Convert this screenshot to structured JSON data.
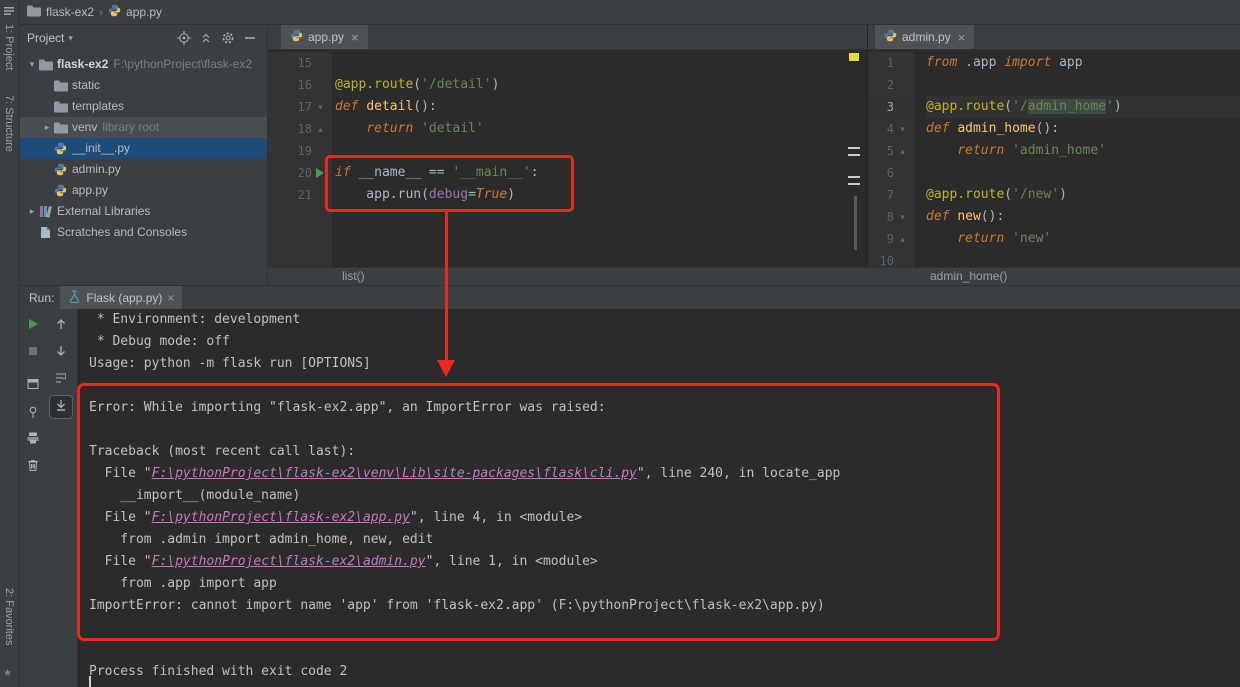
{
  "colors": {
    "panel_bg": "#3c3f41",
    "editor_bg": "#2b2b2b",
    "selection_blue": "#1e4b77",
    "annotation_red": "#ea2820",
    "console_link": "#cb76c0",
    "keyword_orange": "#cc7832",
    "string_green": "#6a8759",
    "decorator_yellow": "#bbb529",
    "function_yellow": "#ffc66b",
    "stripe_yellow": "#dede3f",
    "run_green": "#499c54"
  },
  "left_strip": {
    "project": "1: Project",
    "structure": "7: Structure",
    "favorites": "2: Favorites"
  },
  "top_bar": {
    "project": "flask-ex2",
    "file": "app.py"
  },
  "project": {
    "header": "Project",
    "tree": [
      {
        "label": "flask-ex2",
        "hint": "F:\\pythonProject\\flask-ex2",
        "icon": "folder",
        "chevron": "open",
        "indent": 0,
        "bold": true
      },
      {
        "label": "static",
        "icon": "folder",
        "indent": 1
      },
      {
        "label": "templates",
        "icon": "folder",
        "indent": 1
      },
      {
        "label": "venv",
        "hint": "library root",
        "icon": "folder",
        "chevron": "closed",
        "indent": 1,
        "hover": true
      },
      {
        "label": "__init__.py",
        "icon": "python",
        "indent": 1,
        "selected": true
      },
      {
        "label": "admin.py",
        "icon": "python",
        "indent": 1
      },
      {
        "label": "app.py",
        "icon": "python",
        "indent": 1
      },
      {
        "label": "External Libraries",
        "icon": "libs",
        "chevron": "closed",
        "indent": 0
      },
      {
        "label": "Scratches and Consoles",
        "icon": "scratch",
        "indent": 0
      }
    ]
  },
  "editor_left": {
    "tab": "app.py",
    "breadcrumb": "list()",
    "lines": [
      {
        "n": 15,
        "tokens": []
      },
      {
        "n": 16,
        "tokens": [
          [
            "d",
            "@app.route"
          ],
          [
            "p",
            "("
          ],
          [
            "s",
            "'/detail'"
          ],
          [
            "p",
            ")"
          ]
        ]
      },
      {
        "n": 17,
        "gutter": "fold-open",
        "tokens": [
          [
            "k",
            "def "
          ],
          [
            "f",
            "detail"
          ],
          [
            "p",
            "():"
          ]
        ]
      },
      {
        "n": 18,
        "gutter": "fold-close",
        "tokens": [
          [
            "p",
            "    "
          ],
          [
            "k",
            "return "
          ],
          [
            "s",
            "'detail'"
          ]
        ]
      },
      {
        "n": 19,
        "tokens": []
      },
      {
        "n": 20,
        "gutter": "run",
        "tokens": [
          [
            "k",
            "if "
          ],
          [
            "p",
            "__name__ == "
          ],
          [
            "s",
            "'__main__'"
          ],
          [
            "p",
            ":"
          ]
        ]
      },
      {
        "n": 21,
        "tokens": [
          [
            "p",
            "    app.run("
          ],
          [
            "v",
            "debug"
          ],
          [
            "p",
            "="
          ],
          [
            "k",
            "True"
          ],
          [
            "p",
            ")"
          ]
        ]
      }
    ]
  },
  "editor_right": {
    "tab": "admin.py",
    "breadcrumb": "admin_home()",
    "lines": [
      {
        "n": 1,
        "tokens": [
          [
            "k",
            "from "
          ],
          [
            "p",
            ".app "
          ],
          [
            "k",
            "import "
          ],
          [
            "p",
            "app"
          ]
        ]
      },
      {
        "n": 2,
        "tokens": []
      },
      {
        "n": 3,
        "highlight": true,
        "tokens": [
          [
            "d",
            "@app.route"
          ],
          [
            "p",
            "("
          ],
          [
            "s",
            "'/"
          ],
          [
            "sh",
            "admin_home"
          ],
          [
            "s",
            "'"
          ],
          [
            "p",
            ")"
          ]
        ]
      },
      {
        "n": 4,
        "gutter": "fold-open",
        "tokens": [
          [
            "k",
            "def "
          ],
          [
            "f",
            "admin_home"
          ],
          [
            "p",
            "():"
          ]
        ]
      },
      {
        "n": 5,
        "gutter": "fold-close",
        "tokens": [
          [
            "p",
            "    "
          ],
          [
            "k",
            "return "
          ],
          [
            "s",
            "'admin_home'"
          ]
        ]
      },
      {
        "n": 6,
        "tokens": []
      },
      {
        "n": 7,
        "tokens": [
          [
            "d",
            "@app.route"
          ],
          [
            "p",
            "("
          ],
          [
            "s",
            "'/new'"
          ],
          [
            "p",
            ")"
          ]
        ]
      },
      {
        "n": 8,
        "gutter": "fold-open",
        "tokens": [
          [
            "k",
            "def "
          ],
          [
            "f",
            "new"
          ],
          [
            "p",
            "():"
          ]
        ]
      },
      {
        "n": 9,
        "gutter": "fold-close",
        "tokens": [
          [
            "p",
            "    "
          ],
          [
            "k",
            "return "
          ],
          [
            "s",
            "'new'"
          ]
        ]
      },
      {
        "n": 10,
        "tokens": []
      }
    ]
  },
  "run_panel": {
    "label": "Run:",
    "tab": "Flask (app.py)",
    "console": [
      [
        [
          "t",
          " * Environment: development"
        ]
      ],
      [
        [
          "t",
          " * Debug mode: off"
        ]
      ],
      [
        [
          "t",
          "Usage: python -m flask run [OPTIONS]"
        ]
      ],
      [],
      [
        [
          "t",
          "Error: While importing \"flask-ex2.app\", an ImportError was raised:"
        ]
      ],
      [],
      [
        [
          "t",
          "Traceback (most recent call last):"
        ]
      ],
      [
        [
          "t",
          "  File \""
        ],
        [
          "l",
          "F:\\pythonProject\\flask-ex2\\venv\\Lib\\site-packages\\flask\\cli.py"
        ],
        [
          "t",
          "\", line 240, in locate_app"
        ]
      ],
      [
        [
          "t",
          "    __import__(module_name)"
        ]
      ],
      [
        [
          "t",
          "  File \""
        ],
        [
          "l",
          "F:\\pythonProject\\flask-ex2\\app.py"
        ],
        [
          "t",
          "\", line 4, in <module>"
        ]
      ],
      [
        [
          "t",
          "    from .admin import admin_home, new, edit"
        ]
      ],
      [
        [
          "t",
          "  File \""
        ],
        [
          "l",
          "F:\\pythonProject\\flask-ex2\\admin.py"
        ],
        [
          "t",
          "\", line 1, in <module>"
        ]
      ],
      [
        [
          "t",
          "    from .app import app"
        ]
      ],
      [
        [
          "t",
          "ImportError: cannot import name 'app' from 'flask-ex2.app' (F:\\pythonProject\\flask-ex2\\app.py)"
        ]
      ],
      [],
      [],
      [
        [
          "t",
          "Process finished with exit code 2"
        ]
      ]
    ]
  }
}
